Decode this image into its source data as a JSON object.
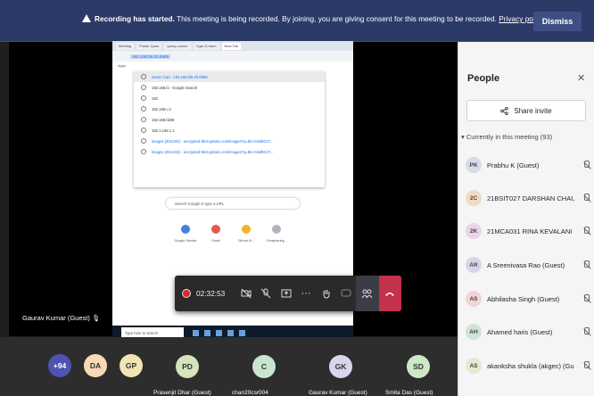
{
  "banner": {
    "bold": "Recording has started.",
    "text": " This meeting is being recorded. By joining, you are giving consent for this meeting to be recorded.",
    "link": "Privacy policy",
    "dismiss": "Dismiss"
  },
  "stage": {
    "presenter_label": "Gaurav Kumar (Guest)",
    "browser": {
      "tabs": [
        "Meeting",
        "Power Ques",
        "query-conver",
        "Type-D mem",
        "New Tab"
      ],
      "url": "192.168.l36.20.6969",
      "bookmarks": "Apps",
      "suggestions": [
        "Green Cart - 192.168.l36.20.6969",
        "192.168.l1 - Google Search",
        "192",
        "192.168.u.1",
        "192.168.l1l88",
        "192.1.168.1.1",
        "images (2l3x192) - encrypted-tbn0.gstatic.com/images?q=tbn:ANd9GcT...",
        "images (2l2x192) - encrypted-tbn0.gstatic.com/images?q=tbn:ANd9GcT..."
      ],
      "search_placeholder": "Search Google or type a URL",
      "shortcuts": [
        "Google Scholar",
        "Gmail",
        "GitHub Ki...",
        "Firesphering..."
      ],
      "taskbar_search": "Type here to search"
    }
  },
  "controls": {
    "timer": "02:32:53"
  },
  "strip": {
    "overflow": "+94",
    "tiles": [
      {
        "initials": "DA",
        "name": ""
      },
      {
        "initials": "GP",
        "name": ""
      },
      {
        "initials": "PD",
        "name": "Prasenjit Dhar (Guest)"
      },
      {
        "initials": "C",
        "name": "chan20csr004"
      },
      {
        "initials": "GK",
        "name": "Gaurav Kumar (Guest)"
      },
      {
        "initials": "SD",
        "name": "Smita Das (Guest)"
      }
    ]
  },
  "people": {
    "title": "People",
    "share_invite": "Share invite",
    "section": "Currently in this meeting (93)",
    "list": [
      {
        "initials": "PK",
        "name": "Prabhu K (Guest)"
      },
      {
        "initials": "2C",
        "name": "21BSIT027 DARSHAN CHAU..."
      },
      {
        "initials": "2K",
        "name": "21MCA031 RINA KEVALANI"
      },
      {
        "initials": "AR",
        "name": "A Sreenivasa Rao (Guest)"
      },
      {
        "initials": "AS",
        "name": "Abhilasha Singh (Guest)"
      },
      {
        "initials": "AH",
        "name": "Ahamed haris (Guest)"
      },
      {
        "initials": "AS",
        "name": "akanksha shukla (akgec) (Gu..."
      }
    ]
  },
  "colors": {
    "banner": "#2b3a67",
    "leave": "#c4314b",
    "recording": "#e0282e"
  }
}
